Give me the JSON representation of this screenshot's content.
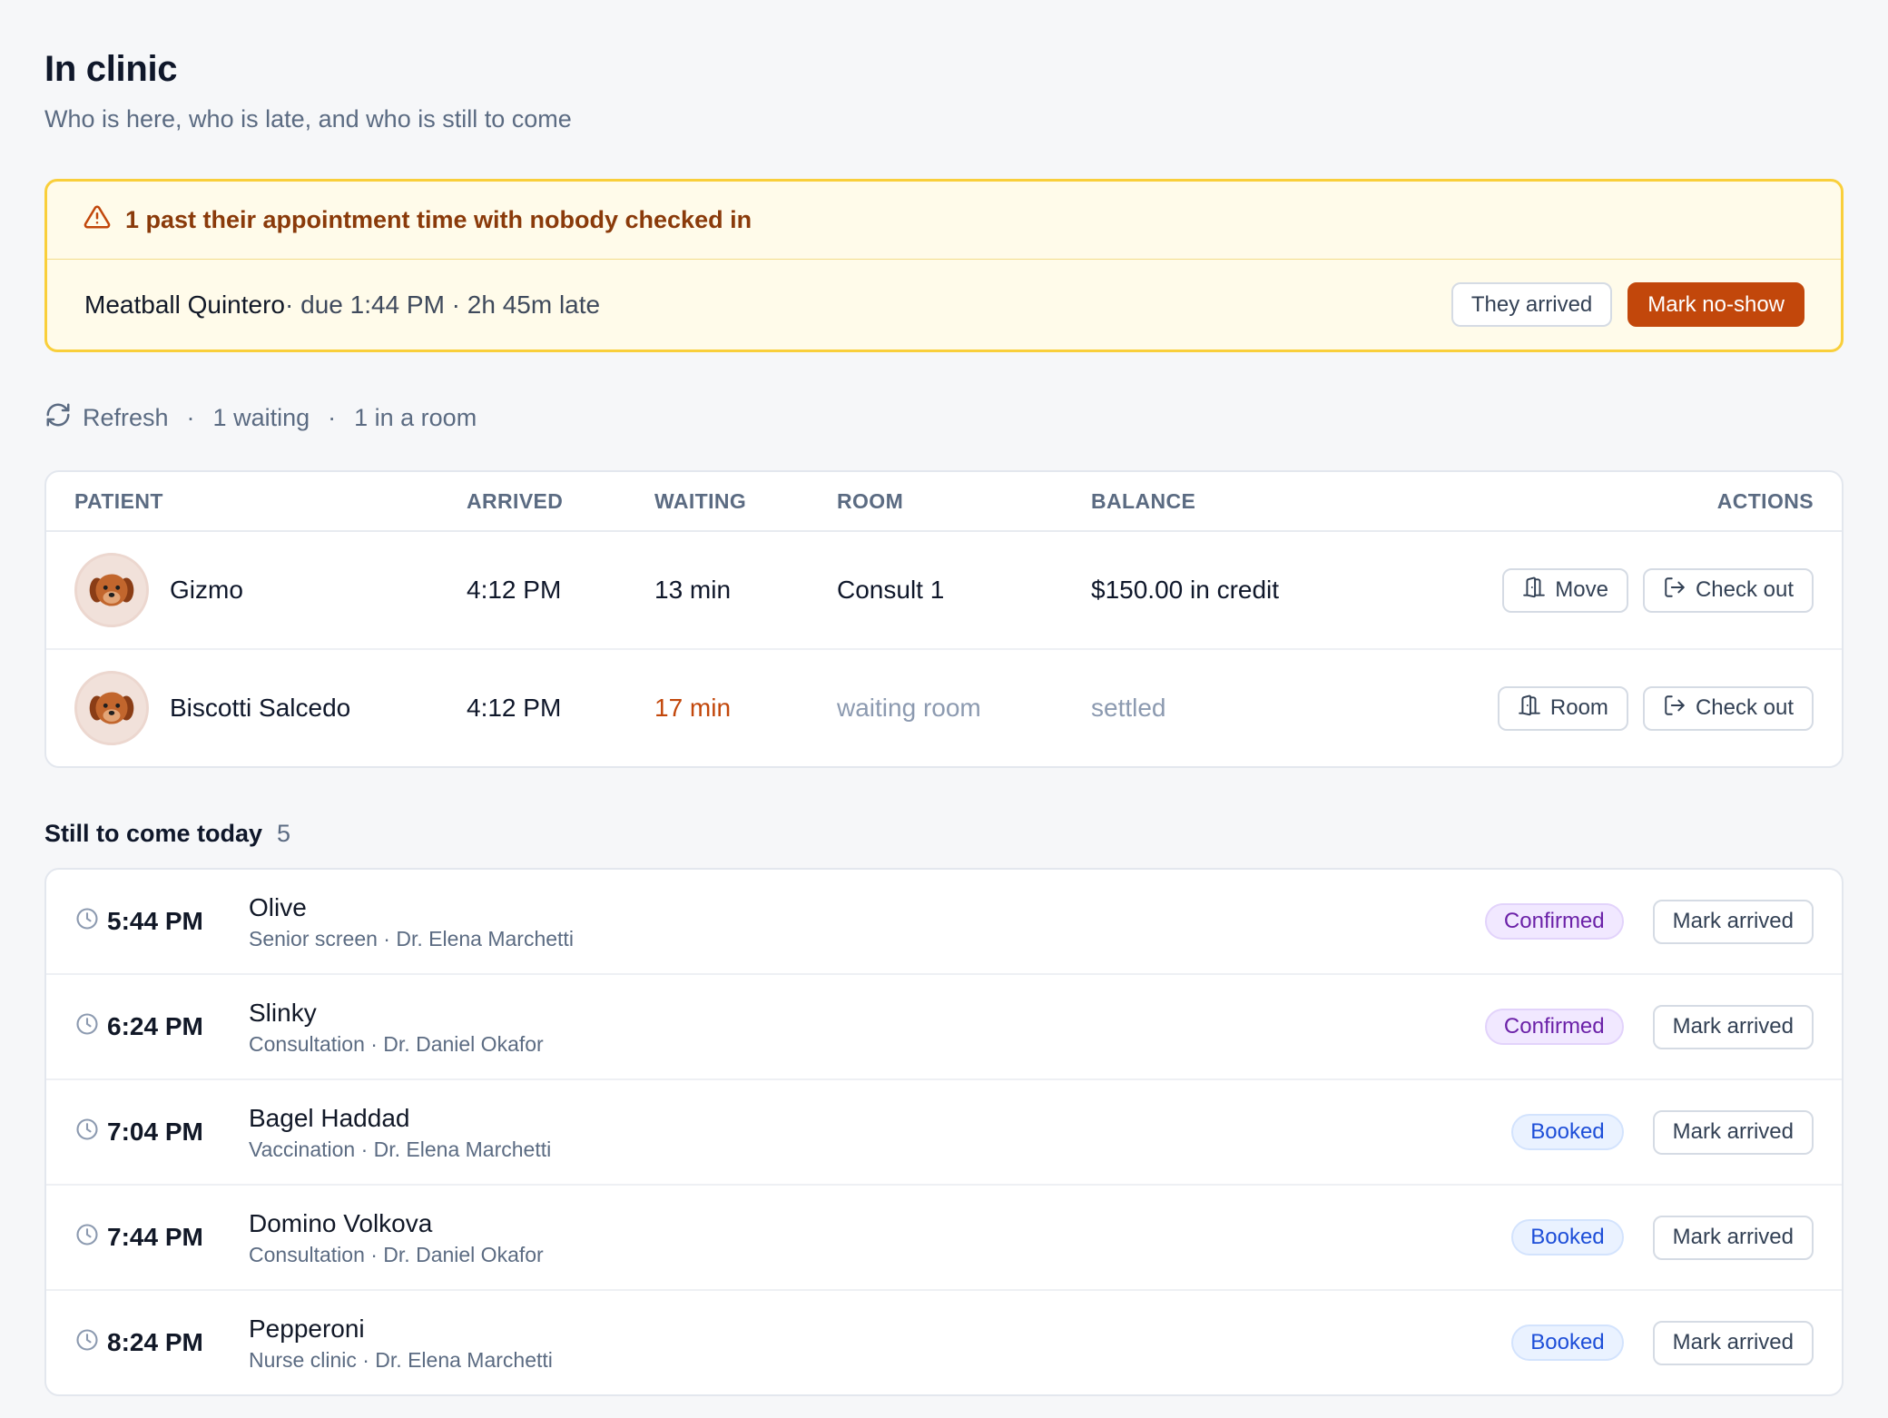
{
  "header": {
    "title": "In clinic",
    "subtitle": "Who is here, who is late, and who is still to come"
  },
  "alert": {
    "icon": "warning-triangle-icon",
    "title": "1 past their appointment time with nobody checked in",
    "patient": "Meatball Quintero",
    "meta": " · due 1:44 PM · 2h 45m late",
    "arrived_label": "They arrived",
    "no_show_label": "Mark no-show"
  },
  "toolbar": {
    "refresh_label": "Refresh",
    "waiting": "1 waiting",
    "in_room": "1 in a room",
    "separator": "·"
  },
  "table": {
    "columns": [
      "PATIENT",
      "ARRIVED",
      "WAITING",
      "ROOM",
      "BALANCE",
      "ACTIONS"
    ],
    "rows": [
      {
        "patient": "Gizmo",
        "arrived": "4:12 PM",
        "waiting": "13 min",
        "room": "Consult 1",
        "balance": "$150.00 in credit",
        "room_action": "Move",
        "checkout": "Check out"
      },
      {
        "patient": "Biscotti Salcedo",
        "arrived": "4:12 PM",
        "waiting": "17 min",
        "room": "waiting room",
        "balance": "settled",
        "room_action": "Room",
        "checkout": "Check out"
      }
    ]
  },
  "upcoming": {
    "title": "Still to come today",
    "count": "5",
    "items": [
      {
        "time": "5:44 PM",
        "name": "Olive",
        "sub": "Senior screen · Dr. Elena Marchetti",
        "status": "Confirmed",
        "action": "Mark arrived"
      },
      {
        "time": "6:24 PM",
        "name": "Slinky",
        "sub": "Consultation · Dr. Daniel Okafor",
        "status": "Confirmed",
        "action": "Mark arrived"
      },
      {
        "time": "7:04 PM",
        "name": "Bagel Haddad",
        "sub": "Vaccination · Dr. Elena Marchetti",
        "status": "Booked",
        "action": "Mark arrived"
      },
      {
        "time": "7:44 PM",
        "name": "Domino Volkova",
        "sub": "Consultation · Dr. Daniel Okafor",
        "status": "Booked",
        "action": "Mark arrived"
      },
      {
        "time": "8:24 PM",
        "name": "Pepperoni",
        "sub": "Nurse clinic · Dr. Elena Marchetti",
        "status": "Booked",
        "action": "Mark arrived"
      }
    ]
  },
  "colors": {
    "alert_border": "#f9cf3b",
    "alert_bg": "#fffbea",
    "danger": "#c2470b",
    "late": "#c2470b",
    "confirmed": "#6b21a8",
    "booked": "#1d4ed8"
  }
}
